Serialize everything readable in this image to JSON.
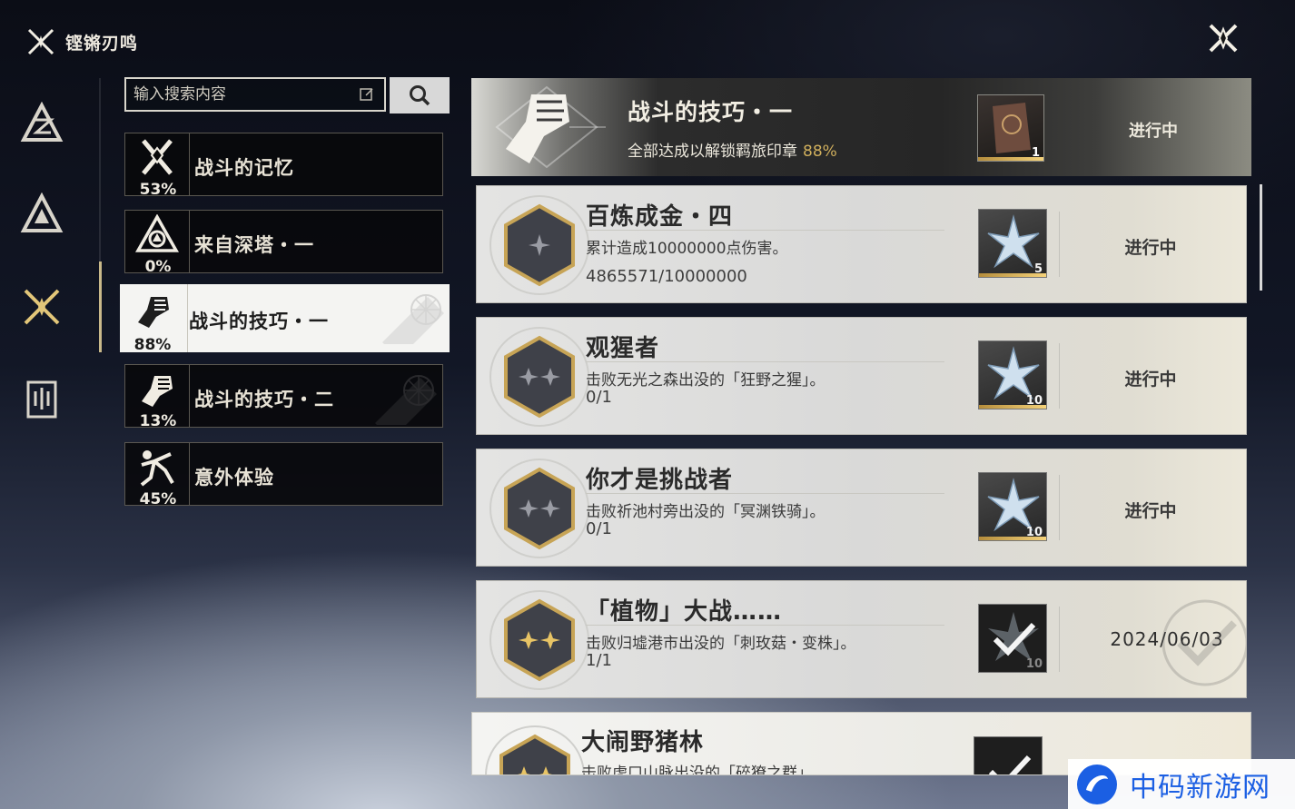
{
  "app": {
    "title": "铿锵刃鸣"
  },
  "search": {
    "placeholder": "输入搜索内容",
    "value": ""
  },
  "categories": [
    {
      "label": "战斗的记忆",
      "percent": "53%",
      "icon": "crossed-swords-icon",
      "active": false
    },
    {
      "label": "来自深塔・一",
      "percent": "0%",
      "icon": "tower-triangle-icon",
      "active": false
    },
    {
      "label": "战斗的技巧・一",
      "percent": "88%",
      "icon": "fist-icon",
      "active": true
    },
    {
      "label": "战斗的技巧・二",
      "percent": "13%",
      "icon": "fist-icon",
      "active": false
    },
    {
      "label": "意外体验",
      "percent": "45%",
      "icon": "falling-person-icon",
      "active": false
    }
  ],
  "summary": {
    "title": "战斗的技巧・一",
    "desc": "全部达成以解锁羁旅印章",
    "percent": "88%",
    "reward_count": "1",
    "status": "进行中"
  },
  "achievements": [
    {
      "title": "百炼成金・四",
      "desc": "累计造成10000000点伤害。",
      "progress": "4865571/10000000",
      "reward_count": "5",
      "status": "进行中",
      "stars": 1,
      "completed": false
    },
    {
      "title": "观猩者",
      "desc": "击败无光之森出没的「狂野之猩」。",
      "progress": "0/1",
      "reward_count": "10",
      "status": "进行中",
      "stars": 2,
      "completed": false
    },
    {
      "title": "你才是挑战者",
      "desc": "击败祈池村旁出没的「冥渊铁骑」。",
      "progress": "0/1",
      "reward_count": "10",
      "status": "进行中",
      "stars": 2,
      "completed": false
    },
    {
      "title": "「植物」大战……",
      "desc": "击败归墟港市出没的「刺玫菇・变株」。",
      "progress": "1/1",
      "reward_count": "10",
      "status": "2024/06/03",
      "stars": 2,
      "completed": true
    },
    {
      "title": "大闹野猪林",
      "desc": "击败虎口山脉出没的「碎獠之群」。",
      "progress": "",
      "reward_count": "",
      "status": "",
      "stars": 2,
      "completed": true
    }
  ],
  "watermark": {
    "text": "中码新游网"
  },
  "colors": {
    "accent_gold": "#cfae5c",
    "active_bg": "#f4f4f2",
    "card_bg": "#e0e0df"
  }
}
